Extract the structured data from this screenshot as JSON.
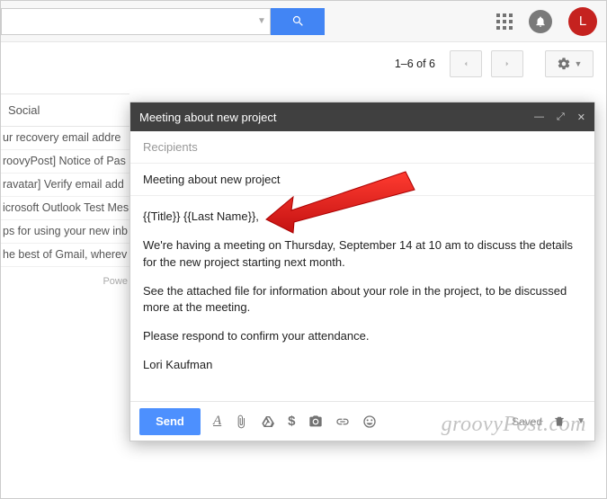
{
  "search": {
    "placeholder": ""
  },
  "avatar_letter": "L",
  "toolbar": {
    "count": "1–6 of 6"
  },
  "left": {
    "tab": "Social",
    "rows": [
      "ur recovery email addre",
      "roovyPost] Notice of Pas",
      "ravatar] Verify email add",
      "icrosoft Outlook Test Mes",
      "ps for using your new inb",
      "he best of Gmail, wherev"
    ],
    "powered": "Powe"
  },
  "compose": {
    "title": "Meeting about new project",
    "recipients_label": "Recipients",
    "subject": "Meeting about new project",
    "body": {
      "greeting": "{{Title}} {{Last Name}},",
      "p1": "We're having a meeting on Thursday, September 14 at 10 am to discuss the details for the new project starting next month.",
      "p2": "See the attached file for information about your role in the project, to be discussed more at the meeting.",
      "p3": "Please respond to confirm your attendance.",
      "sig": "Lori Kaufman"
    },
    "send_label": "Send",
    "saved_label": "Saved"
  },
  "watermark": "groovyPost.com"
}
